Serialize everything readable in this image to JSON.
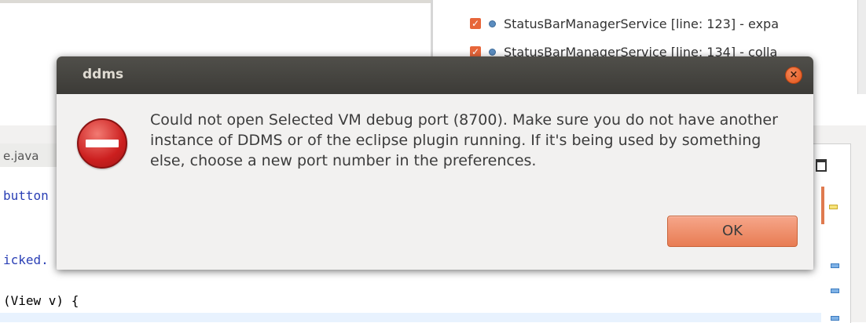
{
  "background": {
    "tree_rows": [
      {
        "label": "StatusBarManagerService [line: 123] - expa",
        "checked": true
      },
      {
        "label": "StatusBarManagerService [line: 134] - colla",
        "checked": true
      }
    ],
    "editor_tab_label": "e.java",
    "code_lines": [
      "button",
      "icked.",
      "(View v) {"
    ]
  },
  "dialog": {
    "title": "ddms",
    "close_label": "×",
    "message": "Could not open Selected VM debug port (8700). Make sure you do not have another instance of DDMS or of the eclipse plugin running. If it's being used by something else, choose a new port number in the preferences.",
    "ok_label": "OK"
  },
  "colors": {
    "titlebar": "#3c3b37",
    "ok_button": "#e87c53",
    "close_button": "#e05418",
    "error_icon": "#cc1f1f"
  }
}
